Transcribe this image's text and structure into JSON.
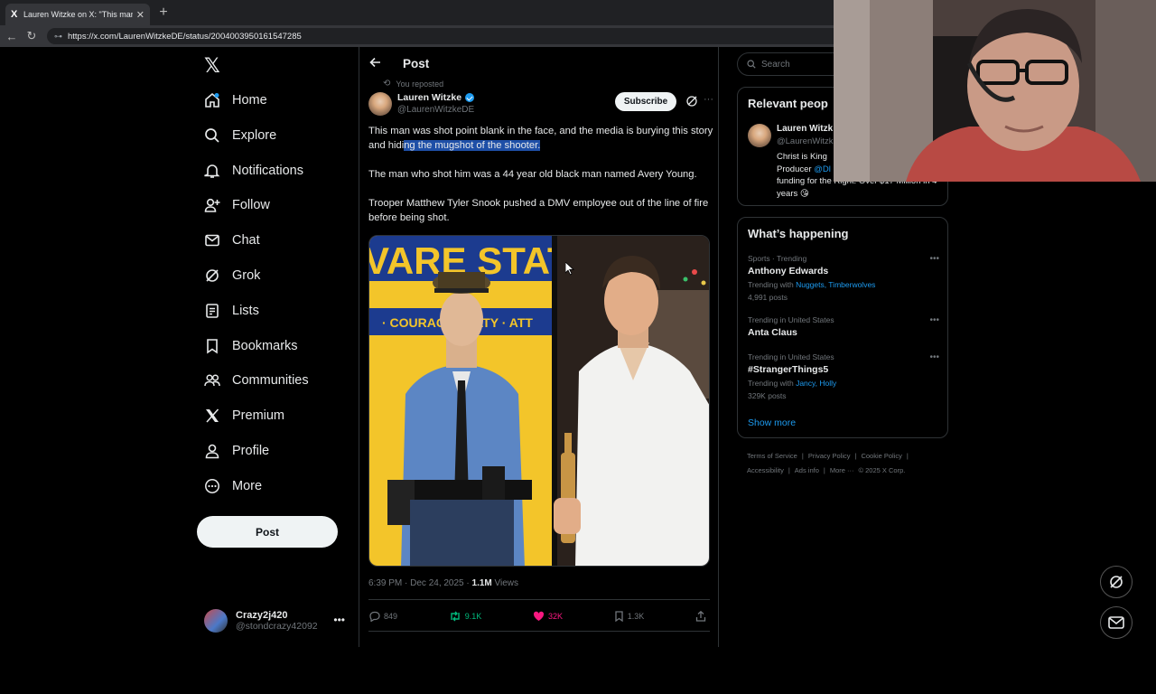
{
  "browser": {
    "tab_title": "Lauren Witzke on X: \"This man wa",
    "tab_favicon": "X",
    "url": "https://x.com/LaurenWitzkeDE/status/2004003950161547285"
  },
  "nav": {
    "items": [
      {
        "label": "Home",
        "icon": "home-icon"
      },
      {
        "label": "Explore",
        "icon": "search-icon"
      },
      {
        "label": "Notifications",
        "icon": "bell-icon"
      },
      {
        "label": "Follow",
        "icon": "add-user-icon"
      },
      {
        "label": "Chat",
        "icon": "mail-icon"
      },
      {
        "label": "Grok",
        "icon": "grok-icon"
      },
      {
        "label": "Lists",
        "icon": "list-icon"
      },
      {
        "label": "Bookmarks",
        "icon": "bookmark-icon"
      },
      {
        "label": "Communities",
        "icon": "people-icon"
      },
      {
        "label": "Premium",
        "icon": "x-icon"
      },
      {
        "label": "Profile",
        "icon": "person-icon"
      },
      {
        "label": "More",
        "icon": "more-circle-icon"
      }
    ],
    "post_label": "Post",
    "account": {
      "name": "Crazy2j420",
      "handle": "@stondcrazy42092"
    }
  },
  "post": {
    "header_title": "Post",
    "repost_note": "You reposted",
    "author_name": "Lauren Witzke",
    "author_handle": "@LaurenWitzkeDE",
    "subscribe_label": "Subscribe",
    "text_p1_a": "This man was shot point blank in the face, and the media is burying this story and hidi",
    "text_p1_b": "ng the mugshot of the shooter.",
    "text_p2": "The man who shot him was a 44 year old black man named Avery Young.",
    "text_p3": "Trooper Matthew Tyler Snook pushed a DMV employee out of the line of fire before being shot.",
    "image_banner_text": "VARE STAT",
    "image_banner_text2": "· COURAG   OYALTY · ATT",
    "timestamp": "6:39 PM · Dec 24, 2025 · ",
    "views_count": "1.1M",
    "views_label": " Views",
    "replies": "849",
    "reposts": "9.1K",
    "likes": "32K",
    "bookmarks": "1.3K"
  },
  "right": {
    "search_placeholder": "Search",
    "relevant_title": "Relevant peop",
    "relevant_person": {
      "name": "Lauren Witzk",
      "handle": "@LaurenWitzk",
      "bio_a": "Christ is King",
      "bio_b": "Producer ",
      "bio_link": "@Dl",
      "bio_c": "funding for the Right. Over $17 Million in 4 years 😘"
    },
    "happening_title": "What’s happening",
    "trends": [
      {
        "cat": "Sports · Trending",
        "name": "Anthony Edwards",
        "with_label": "Trending with ",
        "with_links": "Nuggets, Timberwolves",
        "posts": "4,991 posts"
      },
      {
        "cat": "Trending in United States",
        "name": "Anta Claus",
        "with_label": "",
        "with_links": "",
        "posts": ""
      },
      {
        "cat": "Trending in United States",
        "name": "#StrangerThings5",
        "with_label": "Trending with ",
        "with_links": "Jancy, Holly",
        "posts": "329K posts"
      }
    ],
    "show_more": "Show more",
    "footer": [
      "Terms of Service",
      "|",
      "Privacy Policy",
      "|",
      "Cookie Policy",
      "|",
      "Accessibility",
      "|",
      "Ads info",
      "|",
      "More ···",
      "© 2025 X Corp."
    ]
  },
  "colors": {
    "accent": "#1d9bf0",
    "like": "#f91880",
    "repost": "#00ba7c",
    "highlight": "#1e4fa7"
  }
}
